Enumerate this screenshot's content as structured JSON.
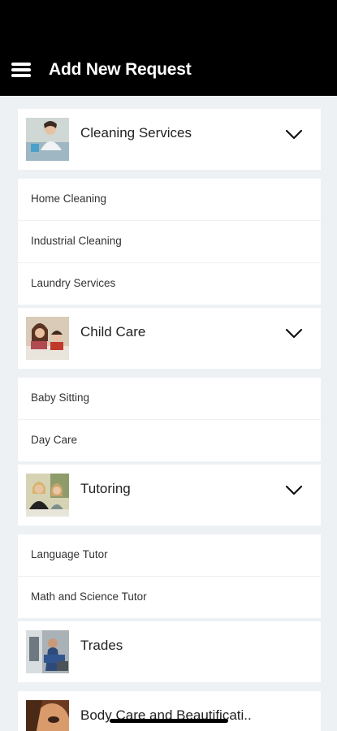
{
  "header": {
    "title": "Add New Request"
  },
  "categories": [
    {
      "label": "Cleaning Services",
      "expanded": true,
      "items": [
        "Home Cleaning",
        "Industrial Cleaning",
        "Laundry Services"
      ]
    },
    {
      "label": "Child Care",
      "expanded": true,
      "items": [
        "Baby Sitting",
        "Day Care"
      ]
    },
    {
      "label": "Tutoring",
      "expanded": true,
      "items": [
        "Language Tutor",
        "Math and Science Tutor"
      ]
    },
    {
      "label": "Trades",
      "expanded": false,
      "items": []
    },
    {
      "label": "Body Care and Beautificati..",
      "expanded": false,
      "items": []
    }
  ],
  "icons": {
    "menu": "hamburger-menu-icon",
    "expand": "chevron-down-icon"
  },
  "colors": {
    "header_bg": "#000000",
    "page_bg": "#eef1f4",
    "card_bg": "#ffffff"
  }
}
